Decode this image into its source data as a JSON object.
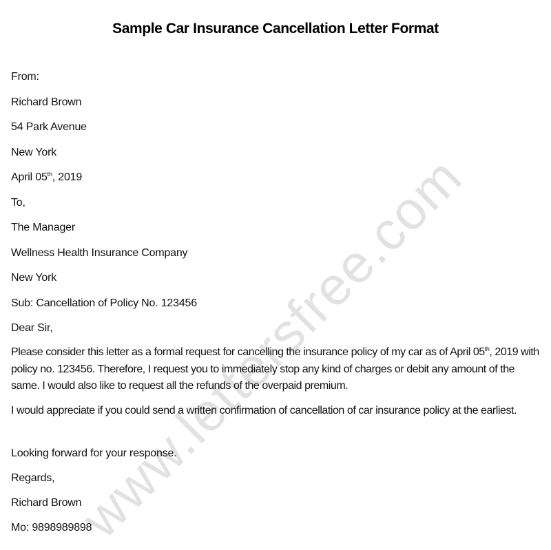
{
  "document": {
    "title": "Sample Car Insurance Cancellation Letter Format",
    "watermark": "www.lettersfree.com",
    "sender": {
      "from_label": "From:",
      "name": "Richard Brown",
      "address": "54 Park Avenue",
      "city": "New York"
    },
    "date": {
      "prefix": "April 05",
      "suffix": "th",
      "rest": ", 2019"
    },
    "recipient": {
      "to_label": "To,",
      "title": "The Manager",
      "company": "Wellness Health Insurance Company",
      "city": "New York"
    },
    "subject": "Sub: Cancellation of Policy No. 123456",
    "salutation": "Dear Sir,",
    "body": {
      "p1_part1": "Please consider this letter as a formal request for cancelling the insurance policy of my car as of April 05",
      "p1_sup": "th",
      "p1_part2": ", 2019 with policy no. 123456. Therefore, I request you to immediately stop any kind of charges or debit any amount of the same. I would also like to request all the refunds of the overpaid premium.",
      "p2": "I would appreciate if you could send a written confirmation of cancellation of car insurance policy at the earliest.",
      "p3": "Looking forward for your response."
    },
    "closing": {
      "regards": "Regards,",
      "name": "Richard Brown",
      "phone": "Mo: 9898989898"
    }
  }
}
